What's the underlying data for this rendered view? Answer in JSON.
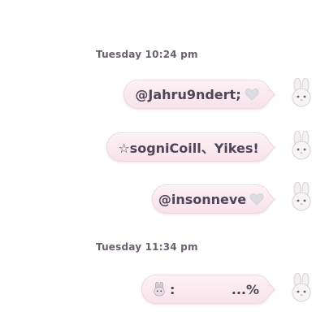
{
  "timestamps": [
    {
      "text": "Tuesday 10:24 pm"
    },
    {
      "text": "Tuesday 11:34 pm"
    }
  ],
  "messages": [
    {
      "text": "@Jahru9ndert;",
      "heart": "grey-heart-icon"
    },
    {
      "text": "☆sogniCoill、Yikes!"
    },
    {
      "text": "@insonneve",
      "heart": "grey-heart-icon"
    },
    {
      "prefix": ":",
      "text": "...%",
      "emoji": "bunny-emoji-icon"
    }
  ],
  "colors": {
    "bubble": "#f7e3ea",
    "bubble_border": "#efd6df",
    "text": "#4f4458",
    "timestamp": "#6a6070",
    "heart": "#d8d8dc"
  },
  "avatar_icon": "bunny-avatar-icon"
}
